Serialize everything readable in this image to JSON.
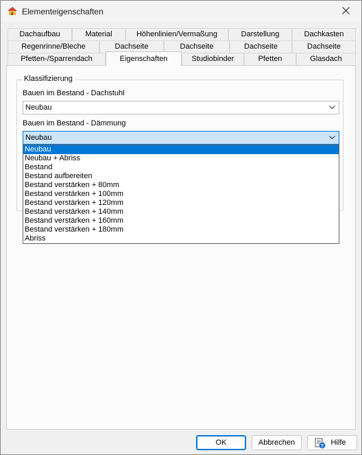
{
  "window": {
    "title": "Elementeigenschaften",
    "icon": "roof-app-icon"
  },
  "tabs": {
    "row1": [
      "Dachaufbau",
      "Material",
      "Höhenlinien/Vermaßung",
      "Darstellung",
      "Dachkasten"
    ],
    "row2": [
      "Regenrinne/Bleche",
      "Dachseite",
      "Dachseite",
      "Dachseite",
      "Dachseite"
    ],
    "row3": [
      "Pfetten-/Sparrendach",
      "Eigenschaften",
      "Studiobinder",
      "Pfetten",
      "Glasdach"
    ],
    "active": "Eigenschaften"
  },
  "classification": {
    "legend": "Klassifizierung",
    "roof_label": "Bauen im Bestand - Dachstuhl",
    "roof_value": "Neubau",
    "insulation_label": "Bauen im Bestand - Dämmung",
    "insulation_value": "Neubau",
    "options": [
      "Neubau",
      "Neubau + Abriss",
      "Bestand",
      "Bestand aufbereiten",
      "Bestand verstärken + 80mm",
      "Bestand verstärken + 100mm",
      "Bestand verstärken + 120mm",
      "Bestand verstärken + 140mm",
      "Bestand verstärken + 160mm",
      "Bestand verstärken + 180mm",
      "Abriss"
    ],
    "selected_option": "Neubau"
  },
  "buttons": {
    "ok": "OK",
    "cancel": "Abbrechen",
    "help": "Hilfe"
  },
  "colors": {
    "accent": "#0078d7",
    "selection_bg": "#cce4f7"
  }
}
